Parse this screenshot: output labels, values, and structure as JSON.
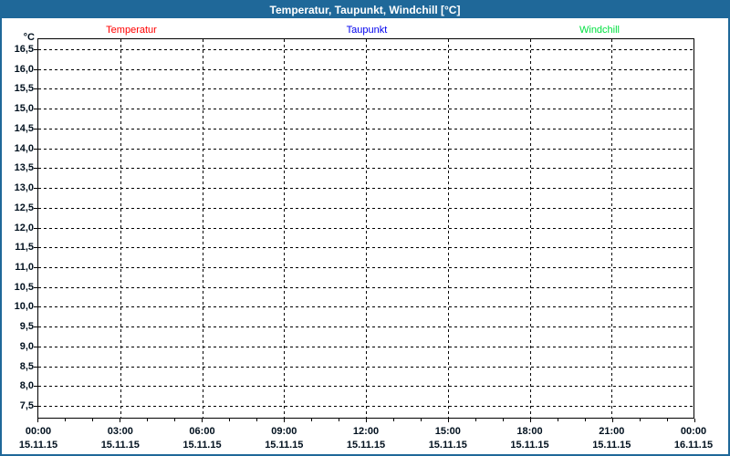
{
  "window": {
    "title": "Temperatur, Taupunkt, Windchill [°C]"
  },
  "colors": {
    "frame": "#1F6899",
    "title_text": "#FFFFFF",
    "background": "#FFFFFF",
    "plot_border": "#000000",
    "grid": "#000000",
    "tick_text": "#00101E"
  },
  "chart_data": {
    "type": "line",
    "title": "Temperatur, Taupunkt, Windchill [°C]",
    "ylabel": "°C",
    "ylim": [
      7.5,
      16.5
    ],
    "ytick_step": 0.5,
    "decimal_separator": ",",
    "ytick_labels": [
      "16,5",
      "16,0",
      "15,5",
      "15,0",
      "14,5",
      "14,0",
      "13,5",
      "13,0",
      "12,5",
      "12,0",
      "11,5",
      "11,0",
      "10,5",
      "10,0",
      "9,5",
      "9,0",
      "8,5",
      "8,0",
      "7,5"
    ],
    "grid": true,
    "grid_style": "dashed",
    "legend_position": "top",
    "x_axis": {
      "range_hours": 24,
      "major_ticks": [
        {
          "time": "00:00",
          "date": "15.11.15"
        },
        {
          "time": "03:00",
          "date": "15.11.15"
        },
        {
          "time": "06:00",
          "date": "15.11.15"
        },
        {
          "time": "09:00",
          "date": "15.11.15"
        },
        {
          "time": "12:00",
          "date": "15.11.15"
        },
        {
          "time": "15:00",
          "date": "15.11.15"
        },
        {
          "time": "18:00",
          "date": "15.11.15"
        },
        {
          "time": "21:00",
          "date": "15.11.15"
        },
        {
          "time": "00:00",
          "date": "16.11.15"
        }
      ],
      "minor_ticks_between_majors": 2
    },
    "series": [
      {
        "name": "Temperatur",
        "color": "#FF0000",
        "values": []
      },
      {
        "name": "Taupunkt",
        "color": "#0000EE",
        "values": []
      },
      {
        "name": "Windchill",
        "color": "#00E040",
        "values": []
      }
    ]
  }
}
